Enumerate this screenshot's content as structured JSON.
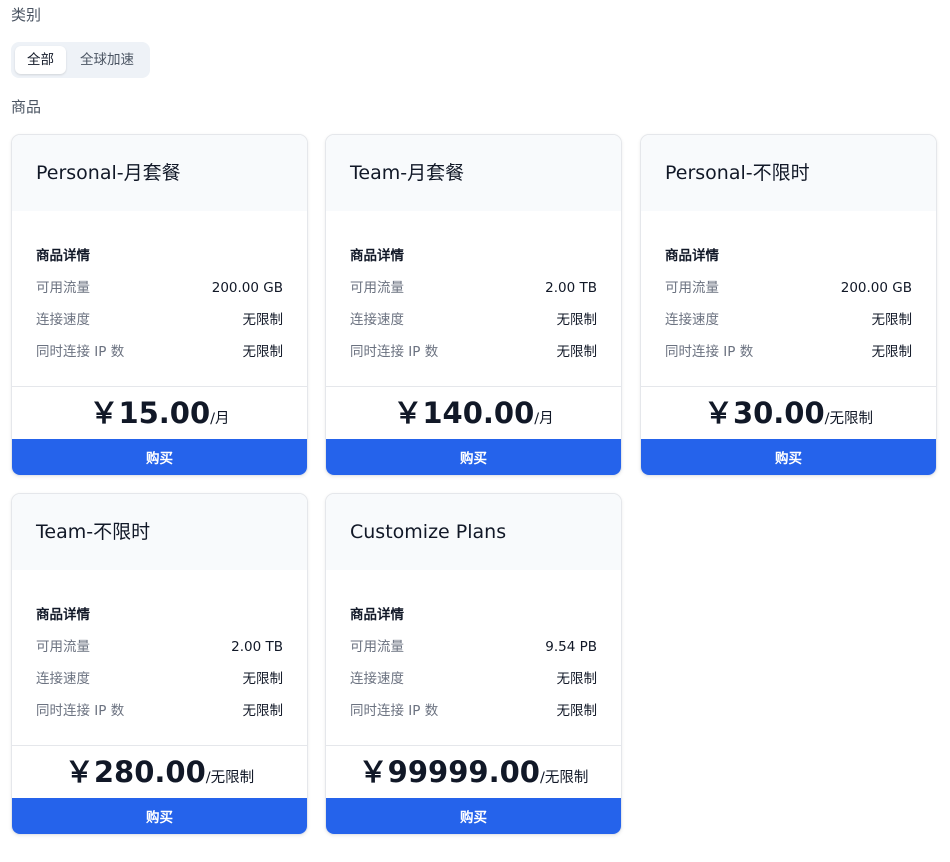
{
  "category_label": "类别",
  "tabs": [
    {
      "label": "全部",
      "active": true
    },
    {
      "label": "全球加速",
      "active": false
    }
  ],
  "products_label": "商品",
  "plans": [
    {
      "title": "Personal-月套餐",
      "details_title": "商品详情",
      "rows": [
        {
          "label": "可用流量",
          "value": "200.00 GB"
        },
        {
          "label": "连接速度",
          "value": "无限制"
        },
        {
          "label": "同时连接 IP 数",
          "value": "无限制"
        }
      ],
      "price": "￥15.00",
      "unit": "/月",
      "buy_label": "购买"
    },
    {
      "title": "Team-月套餐",
      "details_title": "商品详情",
      "rows": [
        {
          "label": "可用流量",
          "value": "2.00 TB"
        },
        {
          "label": "连接速度",
          "value": "无限制"
        },
        {
          "label": "同时连接 IP 数",
          "value": "无限制"
        }
      ],
      "price": "￥140.00",
      "unit": "/月",
      "buy_label": "购买"
    },
    {
      "title": "Personal-不限时",
      "details_title": "商品详情",
      "rows": [
        {
          "label": "可用流量",
          "value": "200.00 GB"
        },
        {
          "label": "连接速度",
          "value": "无限制"
        },
        {
          "label": "同时连接 IP 数",
          "value": "无限制"
        }
      ],
      "price": "￥30.00",
      "unit": "/无限制",
      "buy_label": "购买"
    },
    {
      "title": "Team-不限时",
      "details_title": "商品详情",
      "rows": [
        {
          "label": "可用流量",
          "value": "2.00 TB"
        },
        {
          "label": "连接速度",
          "value": "无限制"
        },
        {
          "label": "同时连接 IP 数",
          "value": "无限制"
        }
      ],
      "price": "￥280.00",
      "unit": "/无限制",
      "buy_label": "购买"
    },
    {
      "title": "Customize Plans",
      "details_title": "商品详情",
      "rows": [
        {
          "label": "可用流量",
          "value": "9.54 PB"
        },
        {
          "label": "连接速度",
          "value": "无限制"
        },
        {
          "label": "同时连接 IP 数",
          "value": "无限制"
        }
      ],
      "price": "￥99999.00",
      "unit": "/无限制",
      "buy_label": "购买"
    }
  ],
  "colors": {
    "accent": "#2563eb",
    "header_bg": "#f8fafc",
    "border": "#e5e7eb"
  }
}
